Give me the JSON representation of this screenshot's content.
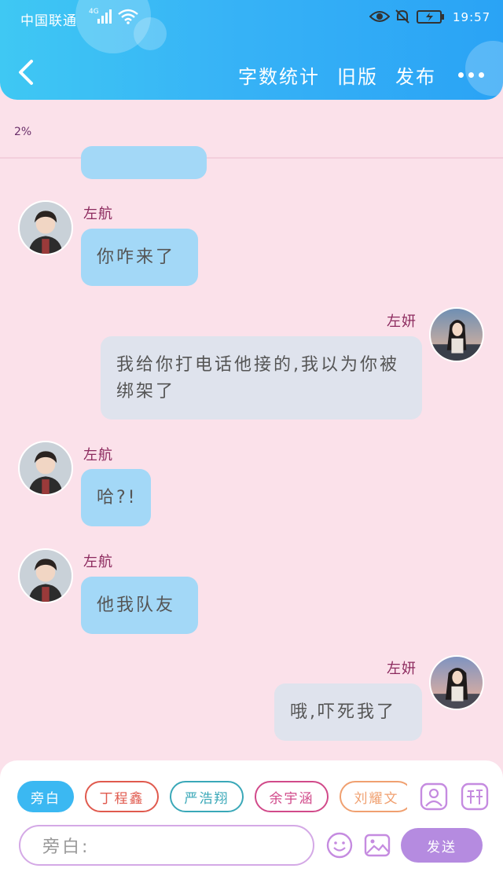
{
  "status_bar": {
    "carrier": "中国联通",
    "network": "4G",
    "time": "19:57"
  },
  "header": {
    "actions": [
      "字数统计",
      "旧版",
      "发布"
    ]
  },
  "progress": "2%",
  "messages": [
    {
      "sender": "左航",
      "text": "你咋来了",
      "side": "left"
    },
    {
      "sender": "左妍",
      "text": "我给你打电话他接的,我以为你被绑架了",
      "side": "right"
    },
    {
      "sender": "左航",
      "text": "哈?!",
      "side": "left"
    },
    {
      "sender": "左航",
      "text": "他我队友",
      "side": "left"
    },
    {
      "sender": "左妍",
      "text": "哦,吓死我了",
      "side": "right"
    }
  ],
  "roles": [
    {
      "label": "旁白",
      "color": "#3bb8f2"
    },
    {
      "label": "丁程鑫",
      "color": "#e05a4e"
    },
    {
      "label": "严浩翔",
      "color": "#3aa8b8"
    },
    {
      "label": "余宇涵",
      "color": "#d14a8a"
    },
    {
      "label": "刘耀文",
      "color": "#f0a070"
    }
  ],
  "composer": {
    "placeholder": "旁白:",
    "send_label": "发送"
  },
  "colors": {
    "header": "#37b3f6",
    "background": "#fbe1ea",
    "bubble_left": "#a3d8f7",
    "bubble_right": "#dfe3ed",
    "send": "#b58be0"
  }
}
